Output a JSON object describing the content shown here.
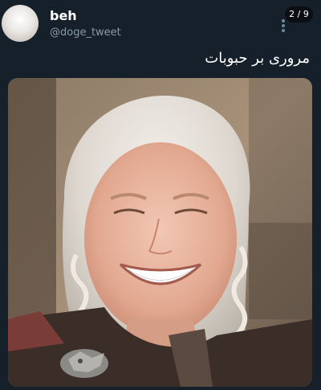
{
  "header": {
    "display_name": "beh",
    "handle": "@doge_tweet",
    "avatar_icon": "avatar-blurred-photo",
    "more_icon": "vertical-dots-icon"
  },
  "carousel": {
    "counter": "2 / 9"
  },
  "tweet": {
    "text": "مروری بر حبوبات"
  },
  "media": {
    "description_icon": "photo-laughing-woman"
  },
  "colors": {
    "background": "#15202b",
    "text_primary": "#ffffff",
    "text_secondary": "#8899a6"
  }
}
